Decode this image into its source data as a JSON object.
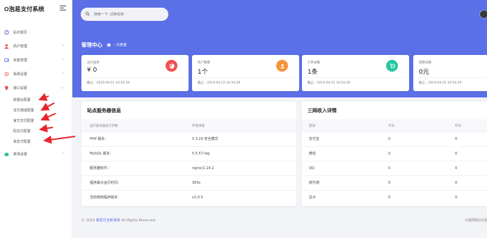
{
  "app": {
    "logo": "O泡易支付系统"
  },
  "sidebar": {
    "items": [
      {
        "label": "站点首页",
        "icon": "dashboard-icon",
        "color": "#5b6fe6"
      },
      {
        "label": "商户管理",
        "icon": "user-icon",
        "color": "#e24a4a"
      },
      {
        "label": "资金管理",
        "icon": "wallet-icon",
        "color": "#5b6fe6"
      },
      {
        "label": "系统设置",
        "icon": "settings-icon",
        "color": "#e24a4a"
      },
      {
        "label": "接口设置",
        "icon": "plug-icon",
        "color": "#e24a4a"
      }
    ],
    "subitems": [
      "收银台配置",
      "支付通道配置",
      "官方支付配置",
      "码支付配置",
      "易支付配置"
    ],
    "last_item": {
      "label": "其他设置",
      "icon": "puzzle-icon",
      "color": "#2bbf8a"
    }
  },
  "search": {
    "placeholder": "搜索一下..切换如果"
  },
  "breadcrumb": {
    "title": "管理中心",
    "current": "仪表盘"
  },
  "cards": [
    {
      "label": "总计盈余",
      "value": "¥ 0",
      "time": "截止：2019-04-22 16:54:29",
      "icon_color": "#f05052",
      "icon": "chart-pie-icon"
    },
    {
      "label": "商户数量",
      "value": "1个",
      "time": "截止：2019-04-22 16:54:29",
      "icon_color": "#f7943a",
      "icon": "user-circle-icon"
    },
    {
      "label": "订单总数",
      "value": "1条",
      "time": "截止：2019-04-22 16:54:29",
      "icon_color": "#26c6a2",
      "icon": "cart-icon"
    },
    {
      "label": "结算总额",
      "value": "0元",
      "time": "截止：2019-04-22 16:54:29",
      "icon_color": "#5b6fe6",
      "icon": "money-icon"
    }
  ],
  "server_panel": {
    "title": "站点服务器信息",
    "headers": [
      "运行服务器运行参数",
      "环境详情"
    ],
    "rows": [
      [
        "PHP 版本：",
        "5.3.29 安全模式"
      ],
      [
        "MySQL 版本：",
        "5.5.57-log"
      ],
      [
        "服务器软件：",
        "nginx/1.14.2"
      ],
      [
        "程序最大运行时间：",
        "300s"
      ],
      [
        "当前使用程序版本：",
        "v1.0.0"
      ]
    ]
  },
  "income_panel": {
    "title": "三网收入详情",
    "headers": [
      "渠道",
      "今日",
      "昨日"
    ],
    "rows": [
      [
        "支付宝",
        "0",
        "0"
      ],
      [
        "微信",
        "0",
        "0"
      ],
      [
        "QQ",
        "0",
        "0"
      ],
      [
        "财付通",
        "0",
        "0"
      ],
      [
        "总计",
        "0",
        "0"
      ]
    ]
  },
  "footer": {
    "prefix": "© 2019",
    "brand": "我爱付全新系统",
    "suffix": "All Rights Reserved.",
    "right": "O泡网络&O泡"
  }
}
